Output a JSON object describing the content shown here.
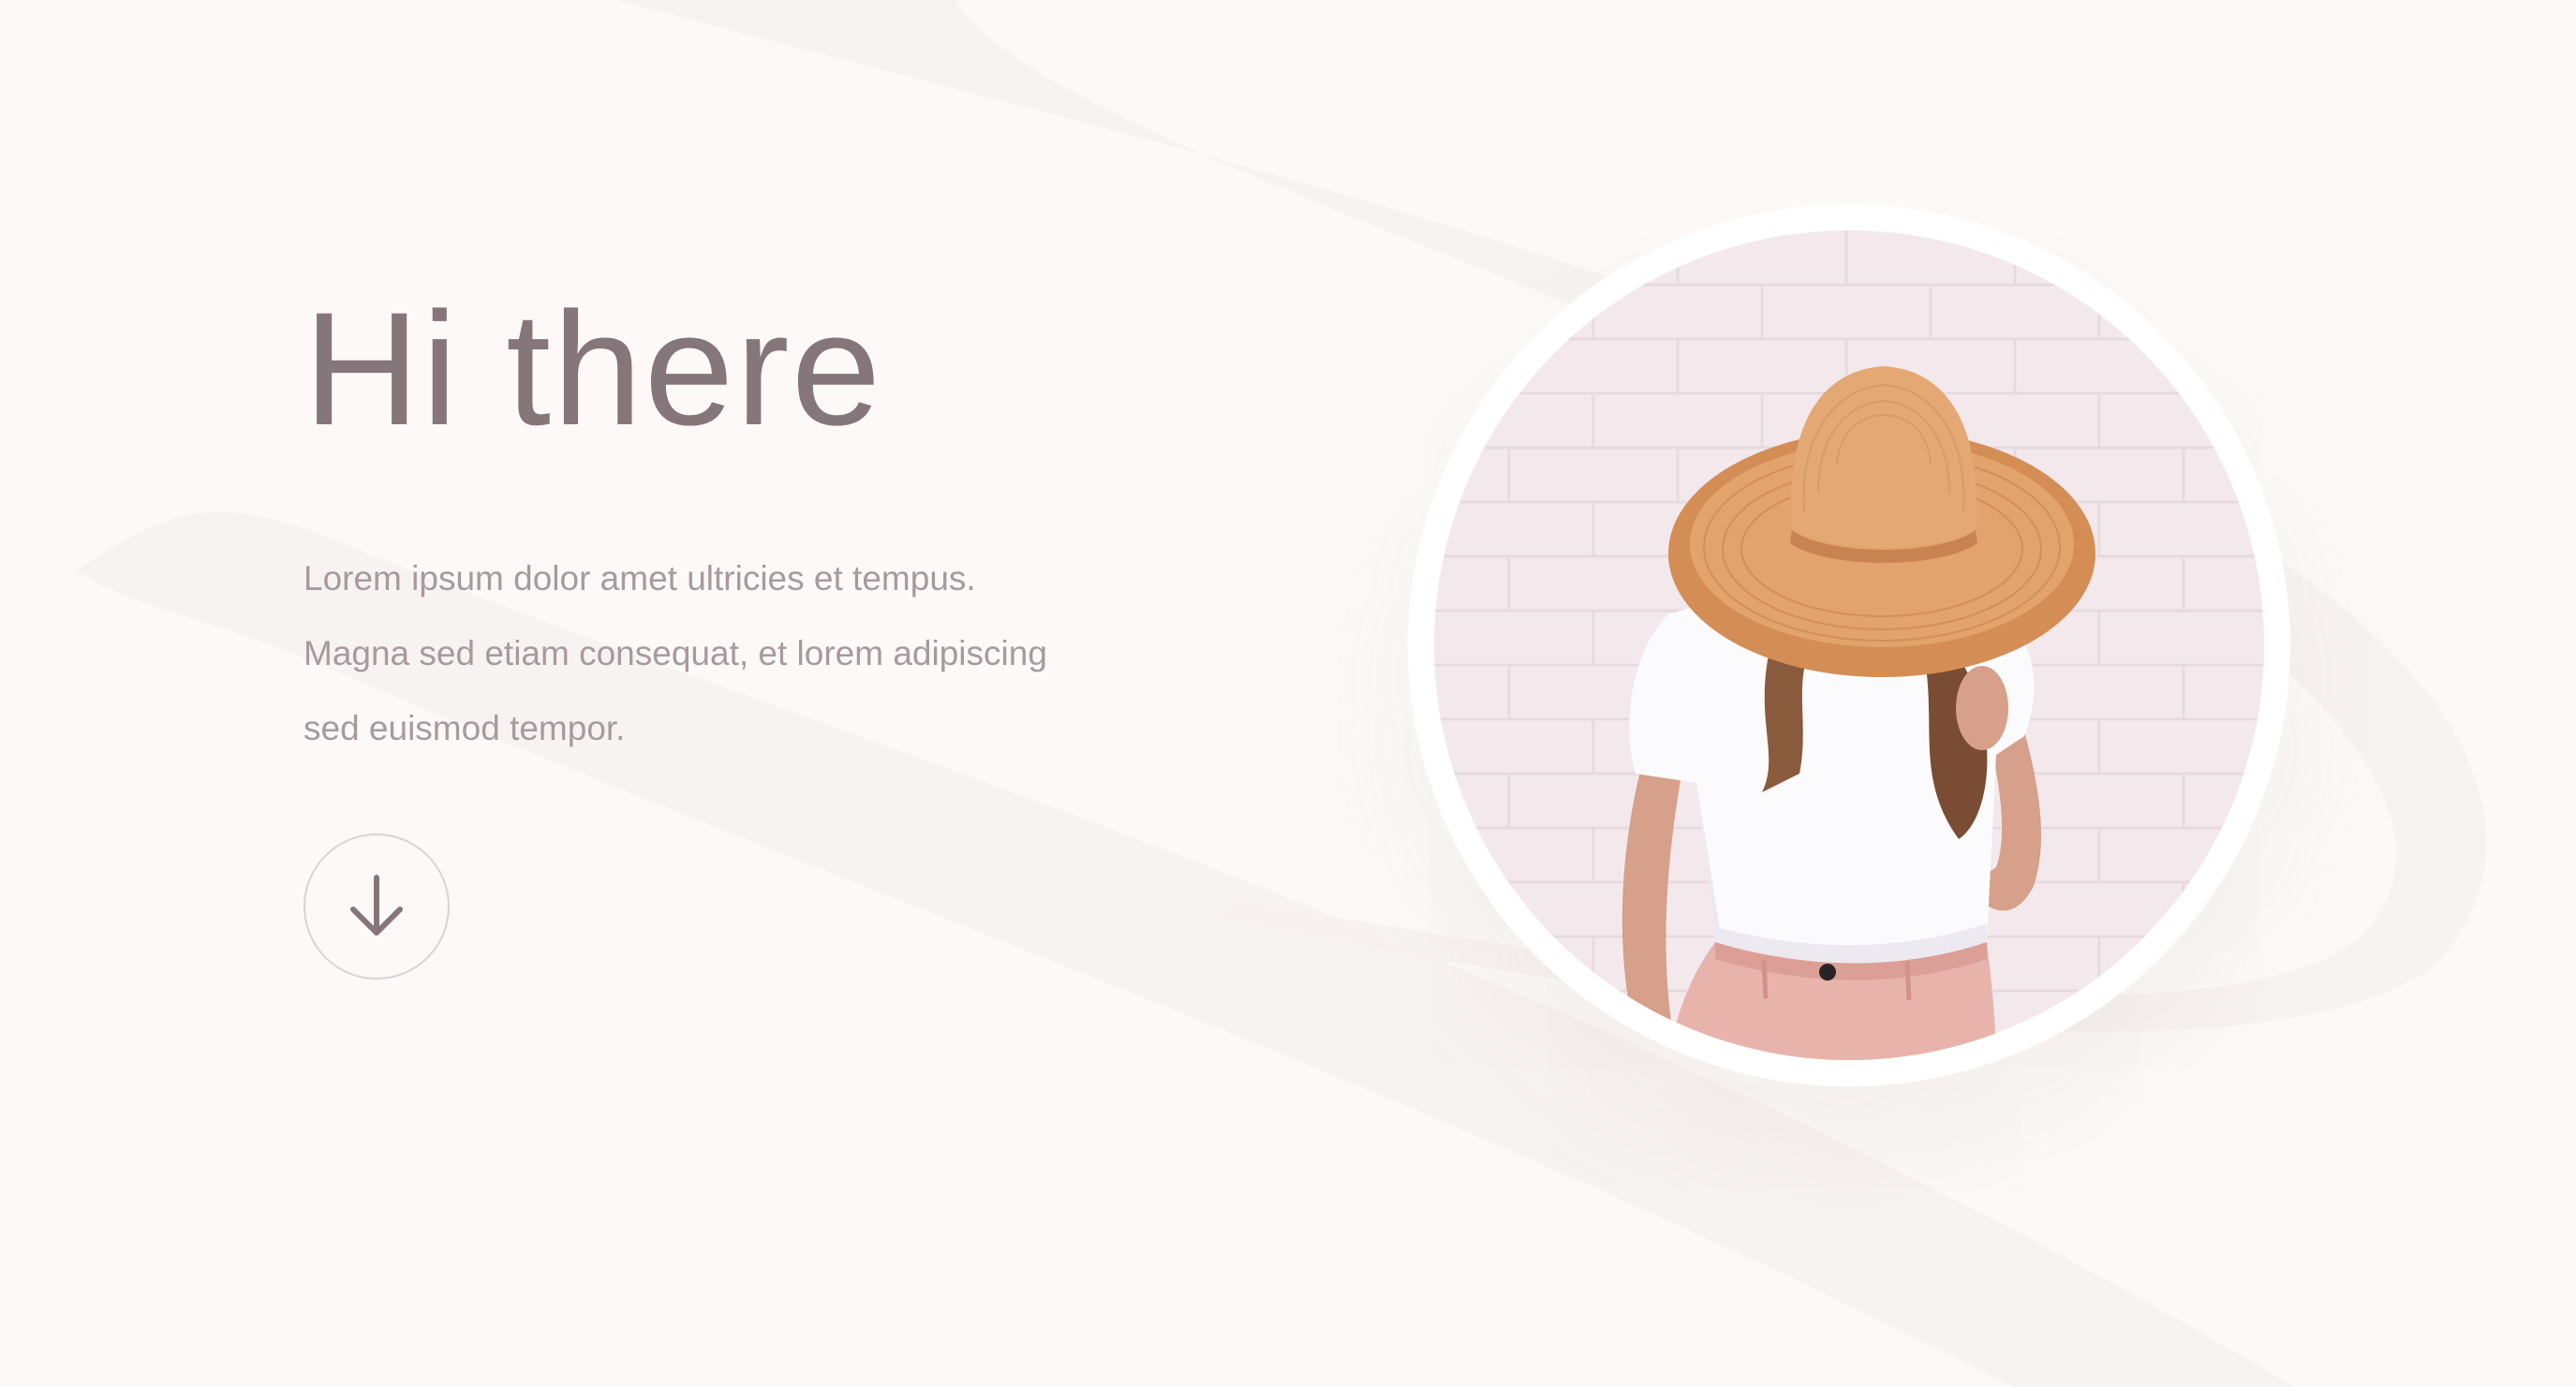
{
  "hero": {
    "title": "Hi there",
    "description_lines": [
      "Lorem ipsum dolor amet ultricies et tempus.",
      "Magna sed etiam consequat, et lorem adipiscing",
      "sed euismod tempor."
    ],
    "scroll_icon": "arrow-down-icon"
  },
  "portrait": {
    "subject": "woman-in-sun-hat-photo"
  },
  "colors": {
    "background": "#fcf9f8",
    "heading": "#85767b",
    "body_text": "#a79a9e",
    "circle_border": "#dcd2d5",
    "hat": "#d99a65",
    "pants": "#e8b3ab"
  }
}
